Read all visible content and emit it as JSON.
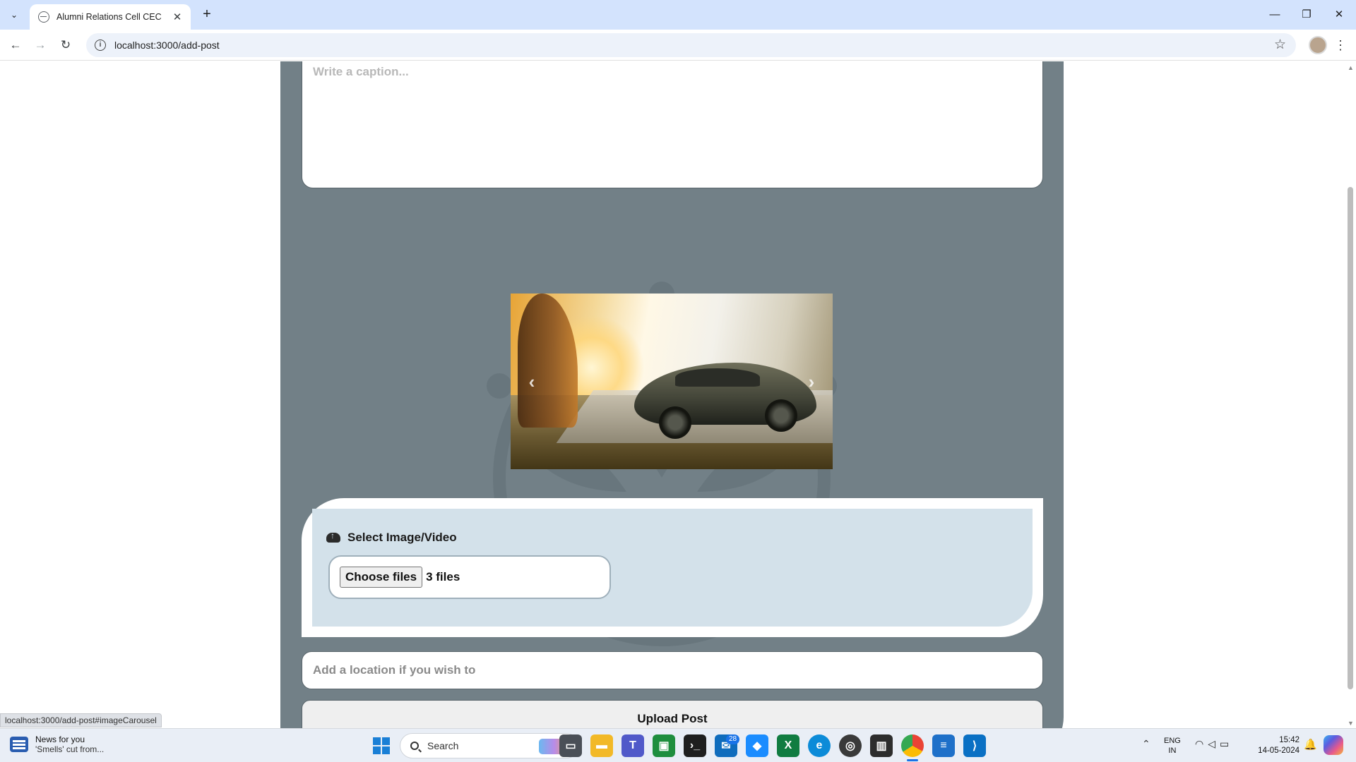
{
  "browser": {
    "tab_title": "Alumni Relations Cell CEC",
    "tab_close": "✕",
    "new_tab": "+",
    "url": "localhost:3000/add-post",
    "window_controls": {
      "minimize": "—",
      "maximize": "❐",
      "close": "✕"
    },
    "status_url": "localhost:3000/add-post#imageCarousel"
  },
  "form": {
    "caption_placeholder": "Write a caption...",
    "carousel": {
      "prev_icon": "‹",
      "next_icon": "›"
    },
    "upload_label": "Select Image/Video",
    "choose_files_label": "Choose files",
    "file_count": "3 files",
    "location_placeholder": "Add a location if you wish to",
    "submit_label": "Upload Post"
  },
  "taskbar": {
    "news_title": "News for you",
    "news_subtitle": "'Smells' cut from...",
    "search_label": "Search",
    "mail_badge": "28",
    "lang_line1": "ENG",
    "lang_line2": "IN",
    "time": "15:42",
    "date": "14-05-2024"
  },
  "colors": {
    "card_bg": "#728087",
    "upload_bg": "#d3e1ea",
    "tab_strip": "#d3e3fd",
    "taskbar_bg": "#e9eef6"
  }
}
